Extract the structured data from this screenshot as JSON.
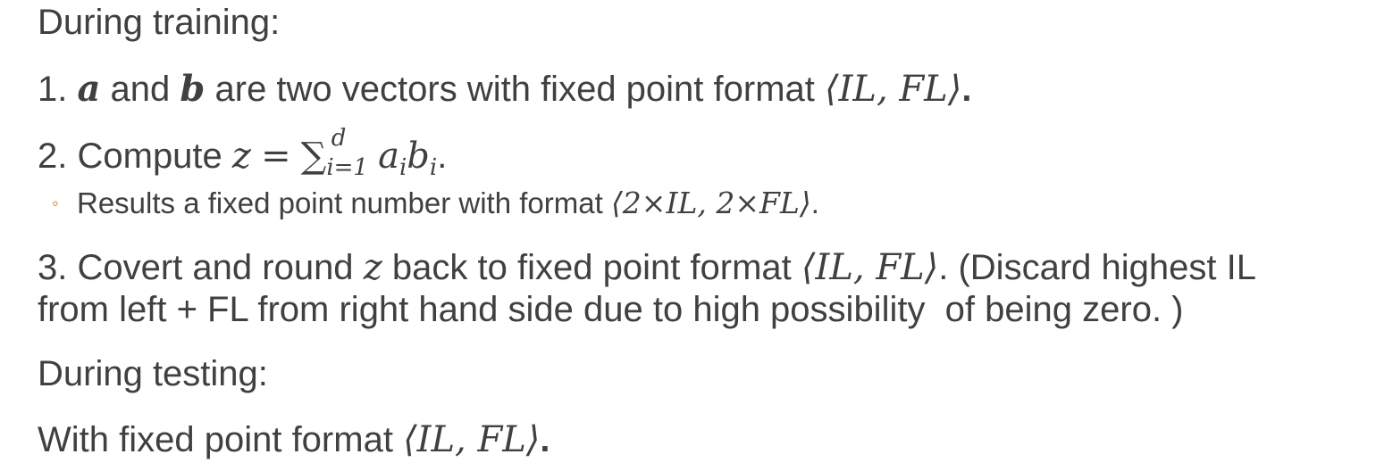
{
  "training_heading": "During training:",
  "step1": {
    "number": "1.",
    "var_a": "a",
    "and": "and",
    "var_b": "b",
    "text": "are two vectors with fixed point format",
    "format": "⟨IL, FL⟩",
    "end": "."
  },
  "step2": {
    "number": "2.",
    "text": "Compute",
    "lhs": "z",
    "eq": "=",
    "sum": "∑",
    "upper": "d",
    "lower": "i=1",
    "a": "a",
    "a_sub": "i",
    "b": "b",
    "b_sub": "i",
    "end": "."
  },
  "step2_bullet": {
    "text": "Results a fixed point number with format",
    "format": "⟨2×IL, 2×FL⟩",
    "end": "."
  },
  "step3": {
    "line1_prefix": "3. Covert and round",
    "var_z": "z",
    "line1_mid": "back to fixed point format",
    "format": "⟨IL, FL⟩",
    "line1_suffix": ". (Discard highest IL",
    "line2": "from left + FL from right hand side due to high possibility  of being zero. )"
  },
  "testing_heading": "During testing:",
  "testing_line": {
    "text": "With fixed point format",
    "format": "⟨IL, FL⟩",
    "end": "."
  },
  "colors": {
    "text": "#404040",
    "bullet": "#e07b10"
  }
}
